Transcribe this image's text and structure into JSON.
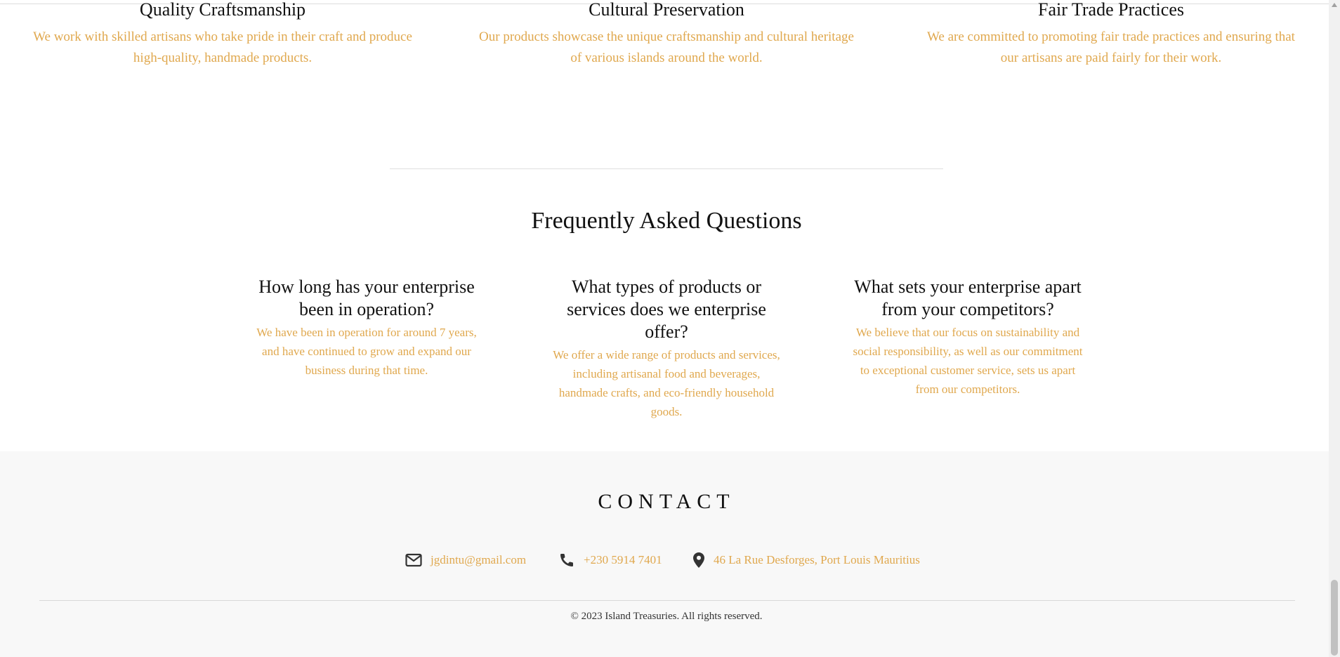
{
  "features": [
    {
      "title": "Quality Craftsmanship",
      "text_line1": "We work with skilled artisans who take pride in their craft and produce",
      "text_line2": "high-quality, handmade products."
    },
    {
      "title": "Cultural Preservation",
      "text_line1": "Our products showcase the unique craftsmanship and cultural heritage",
      "text_line2": "of various islands around the world."
    },
    {
      "title": "Fair Trade Practices",
      "text_line1": "We are committed to promoting fair trade practices and ensuring that",
      "text_line2": "our artisans are paid fairly for their work."
    }
  ],
  "faq": {
    "heading": "Frequently Asked Questions",
    "items": [
      {
        "question_line1": "How long has your enterprise",
        "question_line2": "been in operation?",
        "question_line3": "",
        "answer_line1": "We have been in operation for around 7 years,",
        "answer_line2": "and have continued to grow and expand our",
        "answer_line3": "business during that time.",
        "answer_line4": ""
      },
      {
        "question_line1": "What types of products or",
        "question_line2": "services does we enterprise",
        "question_line3": "offer?",
        "answer_line1": "We offer a wide range of products and services,",
        "answer_line2": "including artisanal food and beverages,",
        "answer_line3": "handmade crafts, and eco-friendly household",
        "answer_line4": "goods."
      },
      {
        "question_line1": "What sets your enterprise apart",
        "question_line2": "from your competitors?",
        "question_line3": "",
        "answer_line1": "We believe that our focus on sustainability and",
        "answer_line2": "social responsibility, as well as our commitment",
        "answer_line3": "to exceptional customer service, sets us apart",
        "answer_line4": "from our competitors."
      }
    ]
  },
  "contact": {
    "heading": "CONTACT",
    "email": "jgdintu@gmail.com",
    "phone": "+230 5914 7401",
    "address": "46 La Rue Desforges, Port Louis Mauritius",
    "icons": {
      "email": "envelope-icon",
      "phone": "phone-icon",
      "address": "map-pin-icon"
    }
  },
  "footer": {
    "copyright": "© 2023 Island Treasuries. All rights reserved."
  },
  "colors": {
    "accent": "#e0a84e",
    "text": "#111111",
    "footer_bg": "#f8f8f8"
  }
}
